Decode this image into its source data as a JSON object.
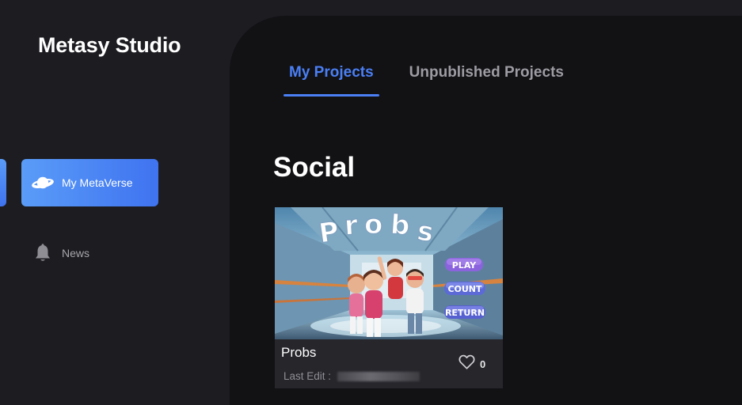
{
  "brand": {
    "title": "Metasy Studio"
  },
  "sidebar": {
    "items": [
      {
        "label": "My MetaVerse",
        "icon": "planet-icon",
        "active": true
      },
      {
        "label": "News",
        "icon": "bell-icon",
        "active": false
      }
    ]
  },
  "tabs": [
    {
      "label": "My Projects",
      "active": true
    },
    {
      "label": "Unpublished Projects",
      "active": false
    }
  ],
  "section": {
    "title": "Social"
  },
  "cards": [
    {
      "title": "Probs",
      "last_edit_label": "Last Edit : ",
      "likes": "0",
      "thumbnail": {
        "logo_text": "Probs",
        "buttons": [
          "PLAY",
          "COUNT",
          "RETURN"
        ]
      }
    }
  ],
  "colors": {
    "accent": "#4a7ff5",
    "sidebar_bg": "#1c1c21",
    "main_bg": "#121215",
    "card_bg": "#26262b"
  }
}
